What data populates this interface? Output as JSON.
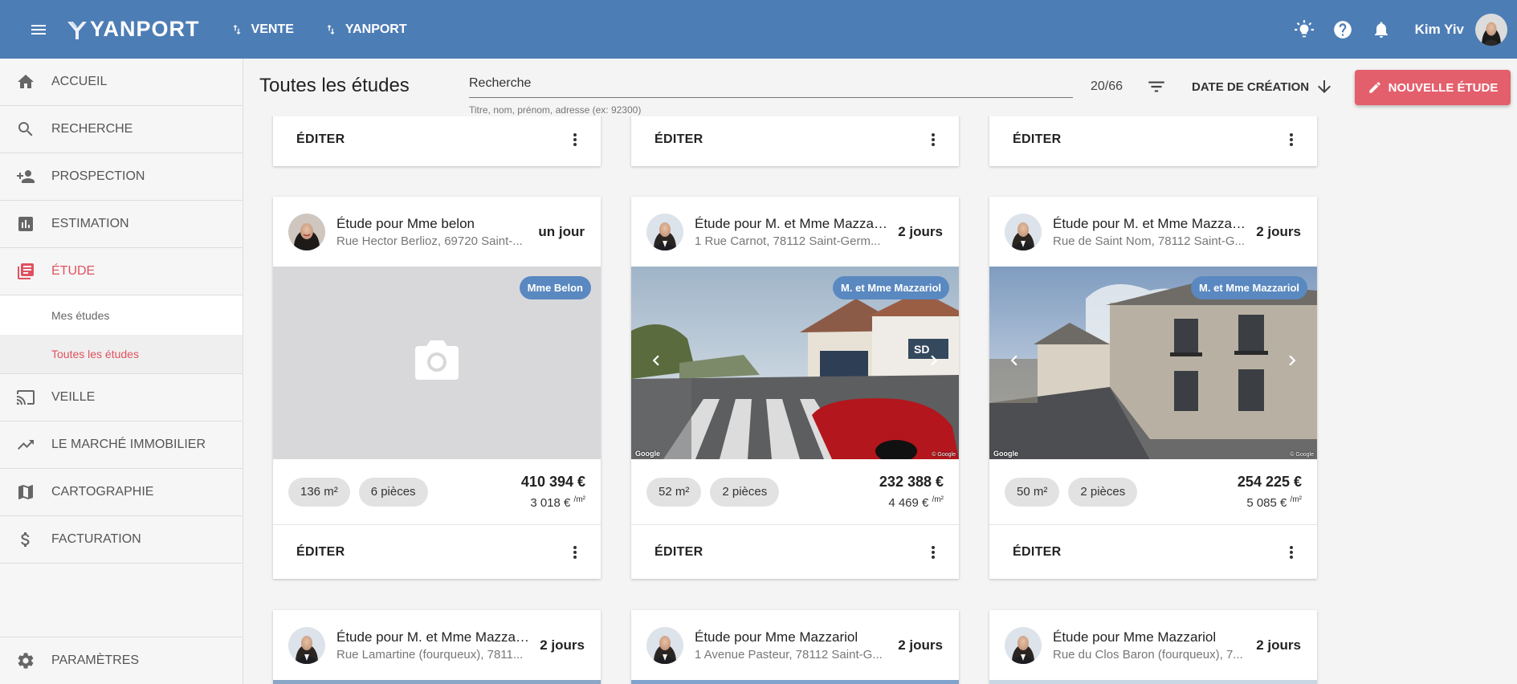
{
  "topbar": {
    "logo": "YANPORT",
    "switches": [
      {
        "label": "VENTE"
      },
      {
        "label": "YANPORT"
      }
    ],
    "user": "Kim Yiv"
  },
  "sidebar": {
    "items": [
      {
        "label": "ACCUEIL",
        "icon": "home-icon"
      },
      {
        "label": "RECHERCHE",
        "icon": "search-icon"
      },
      {
        "label": "PROSPECTION",
        "icon": "person-add-icon"
      },
      {
        "label": "ESTIMATION",
        "icon": "bar-chart-icon"
      },
      {
        "label": "ÉTUDE",
        "icon": "library-books-icon"
      },
      {
        "label": "VEILLE",
        "icon": "cast-icon"
      },
      {
        "label": "LE MARCHÉ IMMOBILIER",
        "icon": "trending-up-icon"
      },
      {
        "label": "CARTOGRAPHIE",
        "icon": "map-icon"
      },
      {
        "label": "FACTURATION",
        "icon": "dollar-icon"
      }
    ],
    "sub_items": [
      {
        "label": "Mes études"
      },
      {
        "label": "Toutes les études"
      }
    ],
    "settings": "PARAMÈTRES"
  },
  "header": {
    "title": "Toutes les études",
    "search_placeholder": "Recherche",
    "search_help": "Titre, nom, prénom, adresse (ex: 92300)",
    "count": "20/66",
    "sort_label": "DATE DE CRÉATION",
    "new_button": "NOUVELLE ÉTUDE"
  },
  "cards_top": [
    {
      "edit": "ÉDITER"
    },
    {
      "edit": "ÉDITER"
    },
    {
      "edit": "ÉDITER"
    }
  ],
  "cards": [
    {
      "title": "Étude pour Mme belon",
      "address": "Rue Hector Berlioz, 69720 Saint-...",
      "age": "un jour",
      "badge": "Mme Belon",
      "surface": "136 m²",
      "rooms": "6 pièces",
      "price": "410 394 €",
      "price_m2": "3 018 €",
      "m2_unit": "/m²",
      "edit": "ÉDITER"
    },
    {
      "title": "Étude pour M. et Mme Mazzari...",
      "address": "1 Rue Carnot, 78112 Saint-Germ...",
      "age": "2 jours",
      "badge": "M. et Mme Mazzariol",
      "surface": "52 m²",
      "rooms": "2 pièces",
      "price": "232 388 €",
      "price_m2": "4 469 €",
      "m2_unit": "/m²",
      "edit": "ÉDITER",
      "google": "Google",
      "copyright": "© Google"
    },
    {
      "title": "Étude pour M. et Mme Mazzari...",
      "address": "Rue de Saint Nom, 78112 Saint-G...",
      "age": "2 jours",
      "badge": "M. et Mme Mazzariol",
      "surface": "50 m²",
      "rooms": "2 pièces",
      "price": "254 225 €",
      "price_m2": "5 085 €",
      "m2_unit": "/m²",
      "edit": "ÉDITER",
      "google": "Google",
      "copyright": "© Google"
    }
  ],
  "cards_bottom": [
    {
      "title": "Étude pour M. et Mme Mazzari...",
      "address": "Rue Lamartine (fourqueux), 7811...",
      "age": "2 jours"
    },
    {
      "title": "Étude pour Mme Mazzariol",
      "address": "1 Avenue Pasteur, 78112 Saint-G...",
      "age": "2 jours"
    },
    {
      "title": "Étude pour Mme Mazzariol",
      "address": "Rue du Clos Baron (fourqueux), 7...",
      "age": "2 jours"
    }
  ],
  "colors": {
    "topbar": "#4d7db5",
    "accent": "#e0515f",
    "new_button": "#e45f6c",
    "badge": "#5a88c0"
  }
}
